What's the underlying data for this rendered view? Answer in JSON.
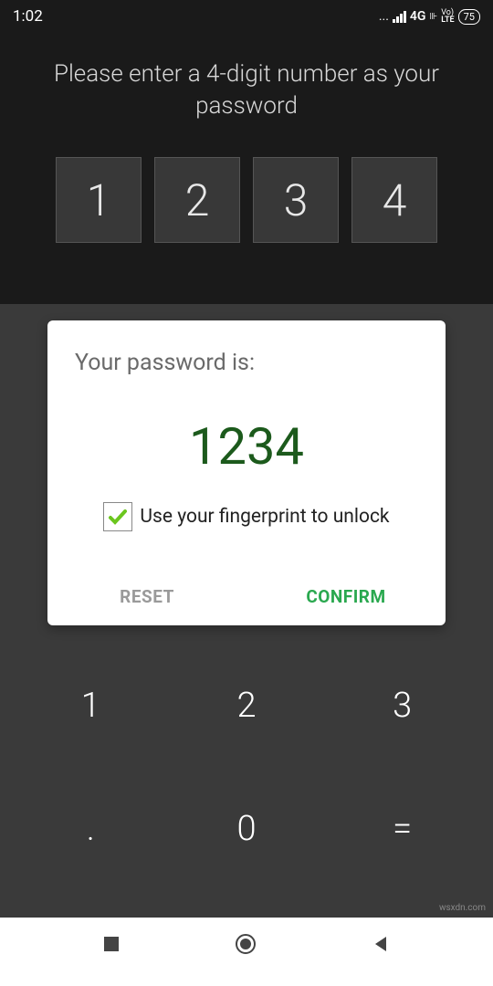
{
  "status": {
    "time": "1:02",
    "dots": "...",
    "network": "4G",
    "volte_top": "Vo)",
    "volte_bottom": "LTE",
    "battery": "75"
  },
  "prompt": "Please enter a 4-digit number as your password",
  "digits": [
    "1",
    "2",
    "3",
    "4"
  ],
  "dialog": {
    "title": "Your password is:",
    "password": "1234",
    "fingerprint_label": "Use your fingerprint to unlock",
    "reset": "RESET",
    "confirm": "CONFIRM"
  },
  "keypad": {
    "k1": "1",
    "k2": "2",
    "k3": "3",
    "k4": ".",
    "k5": "0",
    "k6": "="
  },
  "watermark": "wsxdn.com"
}
